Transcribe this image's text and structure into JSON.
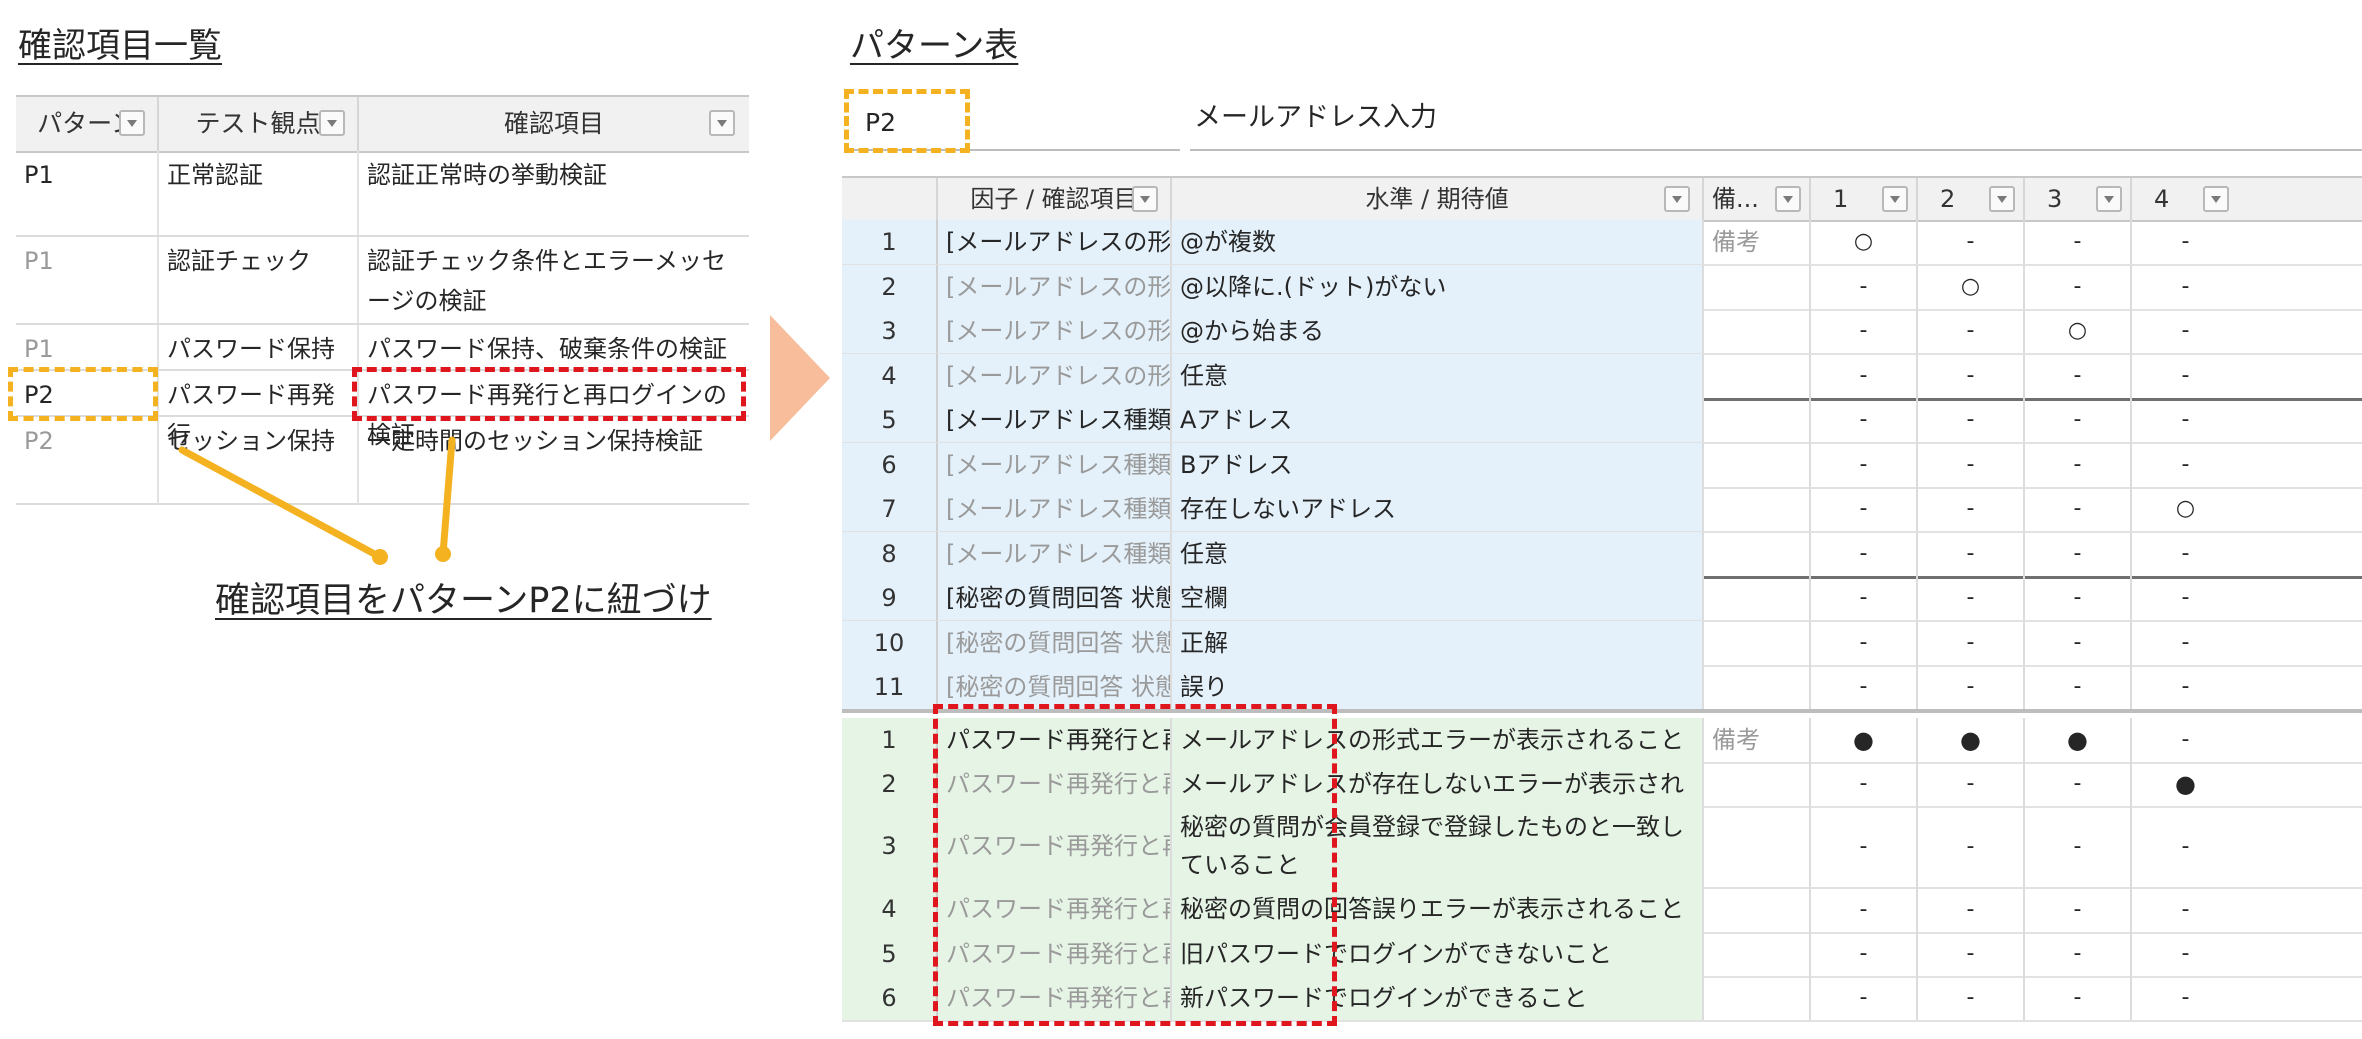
{
  "left": {
    "title": "確認項目一覧",
    "columns": [
      "パターン",
      "テスト観点",
      "確認項目"
    ],
    "rows": [
      {
        "pattern": "P1",
        "aspect": "正常認証",
        "item": "認証正常時の挙動検証"
      },
      {
        "pattern": "P1",
        "aspect": "認証チェック",
        "item": "認証チェック条件とエラーメッセージの検証"
      },
      {
        "pattern": "P1",
        "aspect": "パスワード保持",
        "item": "パスワード保持、破棄条件の検証"
      },
      {
        "pattern": "P2",
        "aspect": "パスワード再発行",
        "item": "パスワード再発行と再ログインの検証"
      },
      {
        "pattern": "P2",
        "aspect": "セッション保持",
        "item": "一定時間のセッション保持検証"
      }
    ],
    "annotation": "確認項目をパターンP2に紐づけ"
  },
  "right": {
    "title": "パターン表",
    "pattern_id": "P2",
    "pattern_name": "メールアドレス入力",
    "columns": {
      "factor": "因子 / 確認項目",
      "level": "水準 / 期待値",
      "remarks": "備...",
      "patterns": [
        "1",
        "2",
        "3",
        "4"
      ]
    },
    "factor_rows": [
      {
        "no": "1",
        "factor": "[メールアドレスの形式種別]",
        "level": "@が複数",
        "remarks": "備考",
        "marks": [
          "○",
          "-",
          "-",
          "-"
        ]
      },
      {
        "no": "2",
        "factor": "[メールアドレスの形式種別]",
        "level": "@以降に.(ドット)がない",
        "remarks": "",
        "marks": [
          "-",
          "○",
          "-",
          "-"
        ]
      },
      {
        "no": "3",
        "factor": "[メールアドレスの形式種別]",
        "level": "@から始まる",
        "remarks": "",
        "marks": [
          "-",
          "-",
          "○",
          "-"
        ]
      },
      {
        "no": "4",
        "factor": "[メールアドレスの形式種別]",
        "level": "任意",
        "remarks": "",
        "marks": [
          "-",
          "-",
          "-",
          "-"
        ]
      },
      {
        "no": "5",
        "factor": "[メールアドレス種類]",
        "level": "Aアドレス",
        "remarks": "",
        "marks": [
          "-",
          "-",
          "-",
          "-"
        ]
      },
      {
        "no": "6",
        "factor": "[メールアドレス種類]",
        "level": "Bアドレス",
        "remarks": "",
        "marks": [
          "-",
          "-",
          "-",
          "-"
        ]
      },
      {
        "no": "7",
        "factor": "[メールアドレス種類]",
        "level": "存在しないアドレス",
        "remarks": "",
        "marks": [
          "-",
          "-",
          "-",
          "○"
        ]
      },
      {
        "no": "8",
        "factor": "[メールアドレス種類]",
        "level": "任意",
        "remarks": "",
        "marks": [
          "-",
          "-",
          "-",
          "-"
        ]
      },
      {
        "no": "9",
        "factor": "[秘密の質問回答 状態]",
        "level": "空欄",
        "remarks": "",
        "marks": [
          "-",
          "-",
          "-",
          "-"
        ]
      },
      {
        "no": "10",
        "factor": "[秘密の質問回答 状態]",
        "level": "正解",
        "remarks": "",
        "marks": [
          "-",
          "-",
          "-",
          "-"
        ]
      },
      {
        "no": "11",
        "factor": "[秘密の質問回答 状態]",
        "level": "誤り",
        "remarks": "",
        "marks": [
          "-",
          "-",
          "-",
          "-"
        ]
      }
    ],
    "check_rows": [
      {
        "no": "1",
        "factor": "パスワード再発行と再ログインの検証",
        "level": "メールアドレスの形式エラーが表示されること",
        "remarks": "備考",
        "marks": [
          "●",
          "●",
          "●",
          "-"
        ]
      },
      {
        "no": "2",
        "factor": "パスワード再発行と再ログインの検証",
        "level": "メールアドレスが存在しないエラーが表示されること",
        "remarks": "",
        "marks": [
          "-",
          "-",
          "-",
          "●"
        ]
      },
      {
        "no": "3",
        "factor": "パスワード再発行と再ログインの検証",
        "level": "秘密の質問が会員登録で登録したものと一致していること",
        "remarks": "",
        "marks": [
          "-",
          "-",
          "-",
          "-"
        ]
      },
      {
        "no": "4",
        "factor": "パスワード再発行と再ログインの検証",
        "level": "秘密の質問の回答誤りエラーが表示されること",
        "remarks": "",
        "marks": [
          "-",
          "-",
          "-",
          "-"
        ]
      },
      {
        "no": "5",
        "factor": "パスワード再発行と再ログインの検証",
        "level": "旧パスワードでログインができないこと",
        "remarks": "",
        "marks": [
          "-",
          "-",
          "-",
          "-"
        ]
      },
      {
        "no": "6",
        "factor": "パスワード再発行と再ログインの検証",
        "level": "新パスワードでログインができること",
        "remarks": "",
        "marks": [
          "-",
          "-",
          "-",
          "-"
        ]
      }
    ]
  },
  "colors": {
    "highlight_yellow": "#f4b221",
    "highlight_red": "#e0161e",
    "arrow": "#f8bd9a",
    "row_blue": "#e4f1fa",
    "row_green": "#e6f4e6"
  },
  "icons": {
    "filter": "dropdown-filter-icon",
    "arrow": "right-arrow-icon"
  }
}
